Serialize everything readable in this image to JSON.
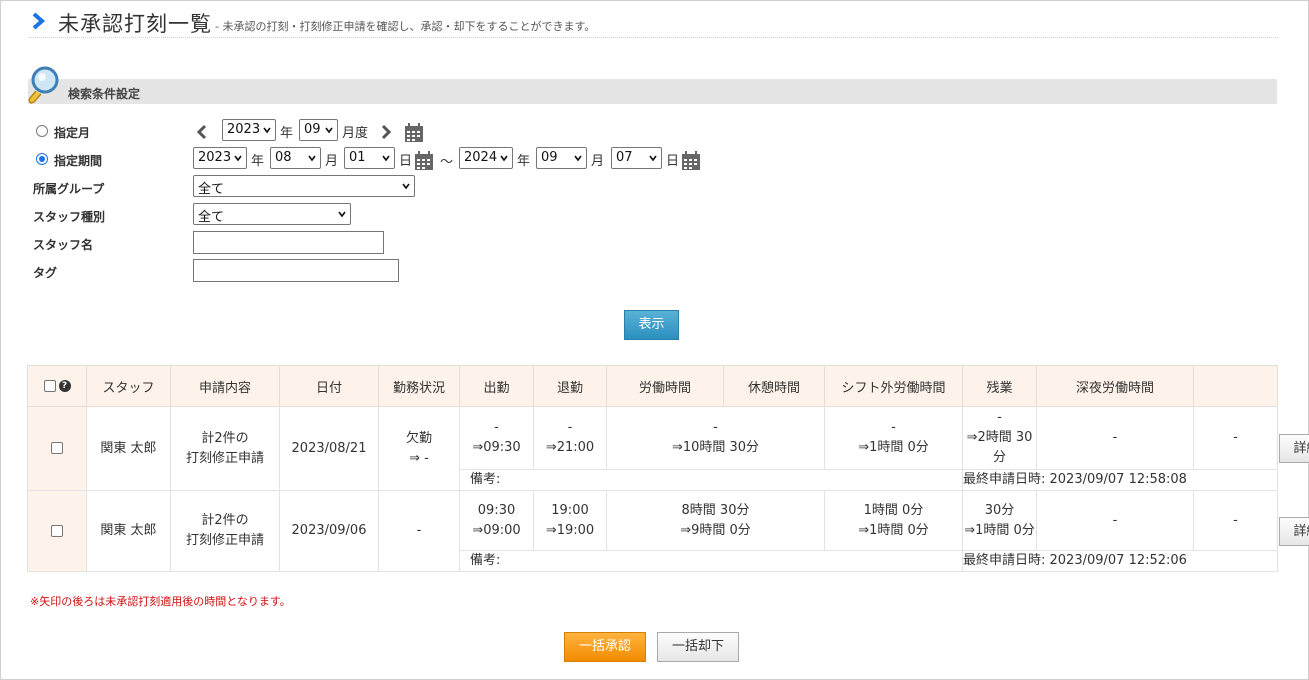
{
  "header": {
    "title": "未承認打刻一覧",
    "subtitle": "- 未承認の打刻・打刻修正申請を確認し、承認・却下をすることができます。"
  },
  "search": {
    "section_label": "検索条件設定",
    "month_label": "指定月",
    "month": {
      "year": "2023",
      "year_unit": "年",
      "month": "09",
      "month_unit": "月度"
    },
    "period_label": "指定期間",
    "period": {
      "from_year": "2023",
      "from_month": "08",
      "from_day": "01",
      "tilde": "～",
      "to_year": "2024",
      "to_month": "09",
      "to_day": "07",
      "year_unit": "年",
      "month_unit": "月",
      "day_unit": "日"
    },
    "group_label": "所属グループ",
    "group_value": "全て",
    "staff_type_label": "スタッフ種別",
    "staff_type_value": "全て",
    "staff_name_label": "スタッフ名",
    "staff_name_value": "",
    "tag_label": "タグ",
    "tag_value": "",
    "show_button": "表示"
  },
  "table": {
    "headers": [
      "スタッフ",
      "申請内容",
      "日付",
      "勤務状況",
      "出勤",
      "退勤",
      "労働時間",
      "休憩時間",
      "シフト外労働時間",
      "残業",
      "深夜労働時間"
    ],
    "help_icon": "?",
    "rows": [
      {
        "staff": "関東 太郎",
        "content": [
          "計2件の",
          "打刻修正申請"
        ],
        "date": "2023/08/21",
        "status": [
          "欠勤",
          "⇒ -"
        ],
        "clock_in": [
          "-",
          "⇒09:30"
        ],
        "clock_out": [
          "-",
          "⇒21:00"
        ],
        "work": [
          "-",
          "⇒10時間 30分"
        ],
        "break": [
          "-",
          "⇒1時間 0分"
        ],
        "offshift": [
          "-",
          "⇒2時間 30分"
        ],
        "overtime": "-",
        "night": "-",
        "note": "備考:",
        "last": "最終申請日時: 2023/09/07 12:58:08",
        "detail": "詳細"
      },
      {
        "staff": "関東 太郎",
        "content": [
          "計2件の",
          "打刻修正申請"
        ],
        "date": "2023/09/06",
        "status": [
          "-",
          ""
        ],
        "clock_in": [
          "09:30",
          "⇒09:00"
        ],
        "clock_out": [
          "19:00",
          "⇒19:00"
        ],
        "work": [
          "8時間 30分",
          "⇒9時間 0分"
        ],
        "break": [
          "1時間 0分",
          "⇒1時間 0分"
        ],
        "offshift": [
          "30分",
          "⇒1時間 0分"
        ],
        "overtime": "-",
        "night": "-",
        "note": "備考:",
        "last": "最終申請日時: 2023/09/07 12:52:06",
        "detail": "詳細"
      }
    ]
  },
  "note": "※矢印の後ろは未承認打刻適用後の時間となります。",
  "actions": {
    "approve": "一括承認",
    "reject": "一括却下"
  },
  "colors": {
    "accent": "#1a73e8",
    "approve": "#f28c00",
    "show": "#2b8fbf",
    "note": "#d01010"
  }
}
